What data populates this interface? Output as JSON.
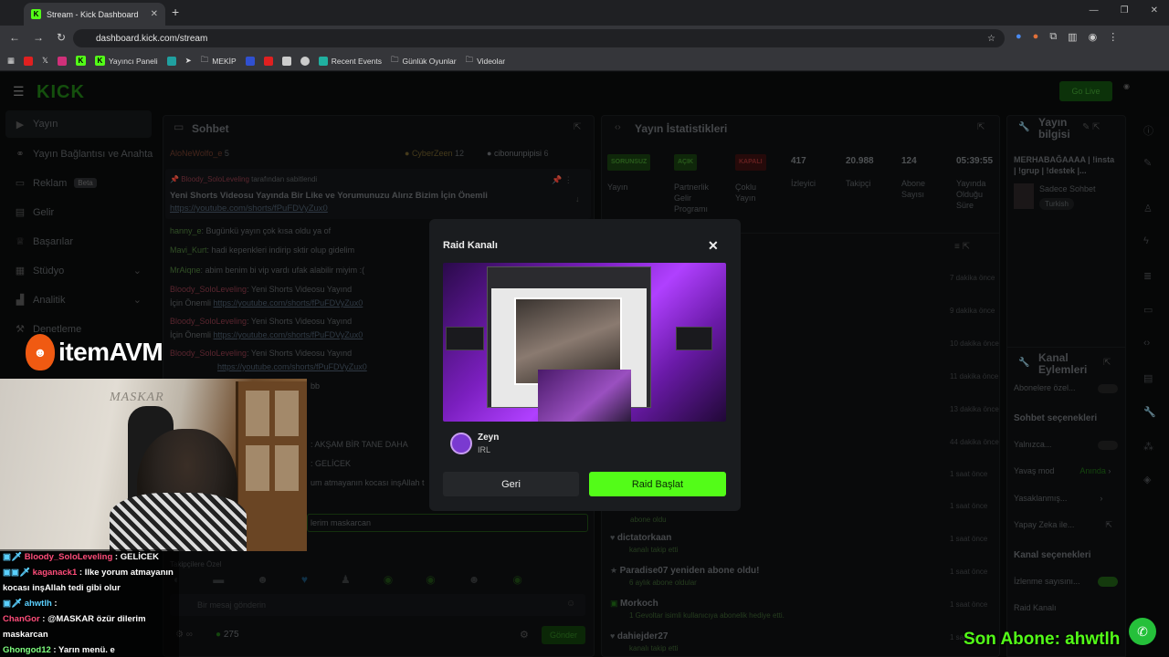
{
  "browser": {
    "tab_title": "Stream - Kick Dashboard",
    "url": "dashboard.kick.com/stream",
    "bookmarks": [
      "Yayıncı Paneli",
      "MEKİP",
      "Recent Events",
      "Günlük Oyunlar",
      "Videolar"
    ]
  },
  "dashboard": {
    "logo": "KICK",
    "go_live": "Go Live",
    "sidebar": [
      {
        "label": "Yayın"
      },
      {
        "label": "Yayın Bağlantısı ve Anahta"
      },
      {
        "label": "Reklam",
        "badge": "Beta"
      },
      {
        "label": "Gelir"
      },
      {
        "label": "Başarılar"
      },
      {
        "label": "Stüdyo"
      },
      {
        "label": "Analitik"
      },
      {
        "label": "Denetleme"
      }
    ],
    "chat": {
      "title": "Sohbet",
      "top_users": [
        {
          "name": "AloNeWolfo_e",
          "count": "5"
        },
        {
          "name": "CyberZeen",
          "count": "12"
        },
        {
          "name": "cibonunpipisi",
          "count": "6"
        }
      ],
      "pinned_by": "Bloody_SoloLeveling",
      "pinned_suffix": "tarafından sabitlendi",
      "pinned_text": "Yeni Shorts Videosu Yayında Bir Like ve Yorumunuzu Alırız Bizim İçin Önemli",
      "pinned_link": "https://youtube.com/shorts/fPuFDVyZux0",
      "messages": [
        {
          "user": "hanny_e",
          "text": ": Bugünkü yayın çok kısa oldu ya of"
        },
        {
          "user": "Mavi_Kurt",
          "text": ": hadi kepenkleri indirip sktir olup gidelim"
        },
        {
          "user": "MrAiqne",
          "text": ": abim benim bi vip vardı ufak alabilir miyim :("
        },
        {
          "user": "Bloody_SoloLeveling",
          "text": ": Yeni Shorts Videosu Yayınd",
          "cont": "İçin Önemli",
          "link": "https://youtube.com/shorts/fPuFDVyZux0"
        },
        {
          "user": "Bloody_SoloLeveling",
          "text": ": Yeni Shorts Videosu Yayınd",
          "cont": "İçin Önemli",
          "link": "https://youtube.com/shorts/fPuFDVyZux0"
        },
        {
          "user": "Bloody_SoloLeveling",
          "text": ": Yeni Shorts Videosu Yayınd",
          "cont": "",
          "link": "https://youtube.com/shorts/fPuFDVyZux0"
        }
      ],
      "partial_lines": [
        "bb",
        ": AKŞAM BİR TANE DAHA",
        ": GELİCEK",
        "um atmayanın kocası inşAllah t",
        "lerim maskarcan"
      ],
      "followers_only": "Takipçilere Özel",
      "input_placeholder": "Bir mesaj gönderin",
      "points": "275",
      "send_label": "Gönder"
    },
    "stats": {
      "title": "Yayın İstatistikleri",
      "items": [
        {
          "badge": "SORUNSUZ",
          "label": "Yayın"
        },
        {
          "badge": "AÇIK",
          "label": "Partnerlik Gelir Programı"
        },
        {
          "badge": "KAPALI",
          "label": "Çoklu Yayın"
        },
        {
          "value": "417",
          "label": "İzleyici"
        },
        {
          "value": "20.988",
          "label": "Takipçi"
        },
        {
          "value": "124",
          "label": "Abone Sayısı"
        },
        {
          "value": "05:39:55",
          "label": "Yayında Olduğu Süre"
        }
      ],
      "feed_times": [
        "7 dakika önce",
        "9 dakika önce",
        "10 dakika önce",
        "11 dakika önce",
        "13 dakika önce",
        "44 dakika önce",
        "1 saat önce",
        "1 saat önce",
        "1 saat önce",
        "1 saat önce",
        "1 saat önce",
        "1 saat önce"
      ],
      "feed": [
        {
          "title": "",
          "sub": "abone oldu"
        },
        {
          "title": "dictatorkaan",
          "sub": "kanalı takip etti"
        },
        {
          "title": "Paradise07 yeniden abone oldu!",
          "sub": "6 aylık abone oldular"
        },
        {
          "title": "Morkoch",
          "sub": "1 Gevoltar isimli kullanıcıya abonelik hediye etti."
        },
        {
          "title": "dahiejder27",
          "sub": "kanalı takip etti"
        }
      ]
    },
    "info": {
      "title": "Yayın bilgisi",
      "stream_title": "MERHABAĞAAAA | !insta | !grup | !destek |...",
      "category": "Sadece Sohbet",
      "language": "Turkish",
      "actions_title": "Kanal Eylemleri",
      "subs_only": "Abonelere özel...",
      "chat_options": "Sohbet seçenekleri",
      "only": "Yalnızca...",
      "slow_mode": "Yavaş mod",
      "slow_value": "Anında",
      "banned": "Yasaklanmış...",
      "ai": "Yapay Zeka ile...",
      "channel_options": "Kanal seçenekleri",
      "view_count": "İzlenme sayısını...",
      "raid": "Raid Kanalı"
    }
  },
  "modal": {
    "title": "Raid Kanalı",
    "channel_name": "Zeyn",
    "channel_category": "IRL",
    "back_label": "Geri",
    "raid_label": "Raid Başlat"
  },
  "stream": {
    "brand_left": "item",
    "brand_right": "AVM",
    "cam_text": "MASKAR",
    "chat": [
      {
        "user": "Bloody_SoloLeveling",
        "text": " : GELİCEK"
      },
      {
        "user": "kaganack1",
        "text": " : Ilke yorum atmayanın",
        "cont": "kocası inşAllah tedi gibi olur"
      },
      {
        "user": "ahwtlh",
        "text": " : "
      },
      {
        "user": "ChanGor",
        "text": " : @MASKAR özür dilerim",
        "cont": "maskarcan"
      },
      {
        "user": "Ghongod12",
        "text": " : Yarın menü. e"
      }
    ],
    "last_sub": "Son Abone: ahwtlh"
  },
  "colors": {
    "kick_green": "#53fc18",
    "brand_orange": "#f05a12"
  }
}
